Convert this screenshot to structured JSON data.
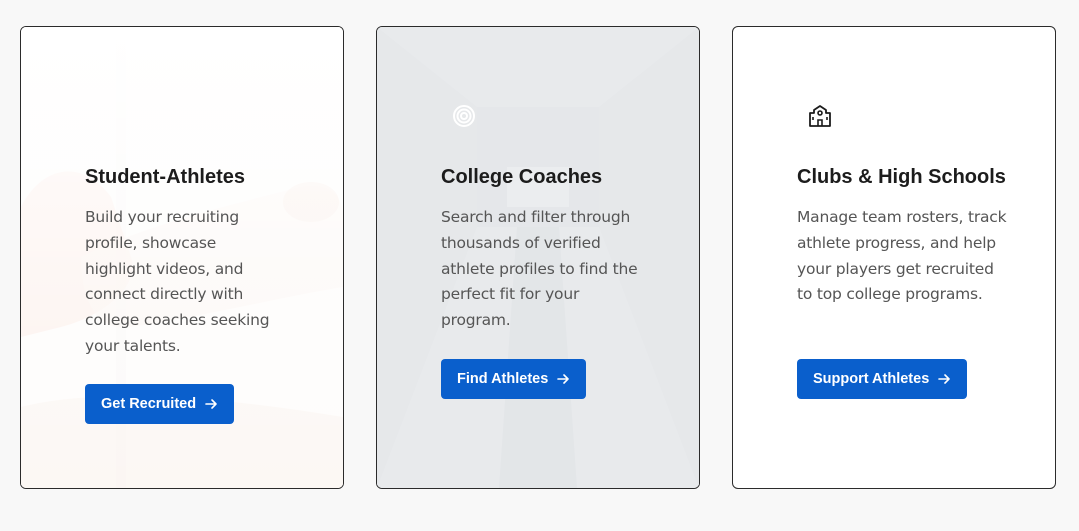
{
  "colors": {
    "page_bg": "#f8f8f8",
    "card_border": "#2b2b2b",
    "button_bg": "#0a5fcc",
    "button_text": "#ffffff",
    "title_text": "#1c1c1c",
    "desc_text": "#555555"
  },
  "cards": [
    {
      "title": "Student-Athletes",
      "description": "Build your recruiting profile, showcase highlight videos, and connect directly with college coaches seeking your talents.",
      "button_label": "Get Recruited",
      "icon": "athlete-photo-background"
    },
    {
      "title": "College Coaches",
      "description": "Search and filter through thousands of verified athlete profiles to find the perfect fit for your program.",
      "button_label": "Find Athletes",
      "icon": "target-icon"
    },
    {
      "title": "Clubs & High Schools",
      "description": "Manage team rosters, track athlete progress, and help your players get recruited to top college programs.",
      "button_label": "Support Athletes",
      "icon": "school-building-icon"
    }
  ]
}
